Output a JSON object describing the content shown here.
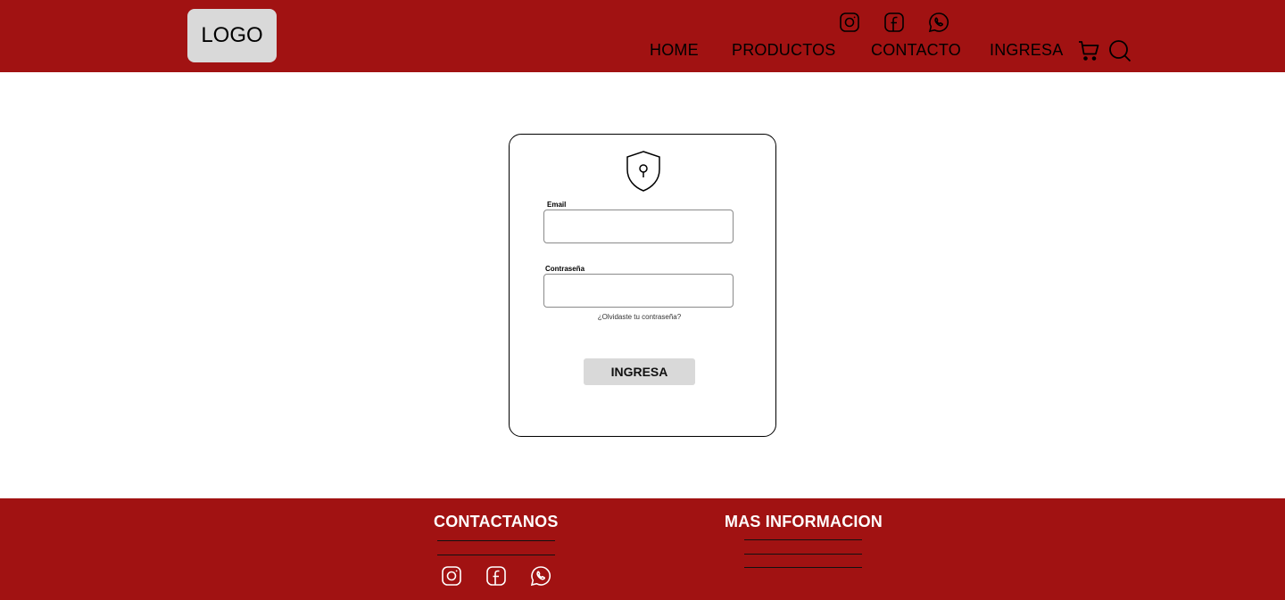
{
  "header": {
    "logo_text": "LOGO",
    "social_icons": [
      "instagram-icon",
      "facebook-icon",
      "whatsapp-icon"
    ],
    "nav": [
      "HOME",
      "PRODUCTOS",
      "CONTACTO",
      "INGRESA"
    ],
    "action_icons": [
      "cart-icon",
      "search-icon"
    ]
  },
  "login": {
    "icon": "shield-lock-icon",
    "email_label": "Email",
    "email_value": "",
    "password_label": "Contraseña",
    "password_value": "",
    "forgot_link": "¿Olvidaste tu contraseña?",
    "submit_label": "INGRESA"
  },
  "footer": {
    "contact_title": "CONTACTANOS",
    "info_title": "MAS INFORMACION",
    "social_icons": [
      "instagram-icon",
      "facebook-icon",
      "whatsapp-icon"
    ]
  },
  "colors": {
    "brand_red": "#a11212",
    "logo_bg": "#d9d9d9",
    "button_bg": "#d9d9d9"
  }
}
